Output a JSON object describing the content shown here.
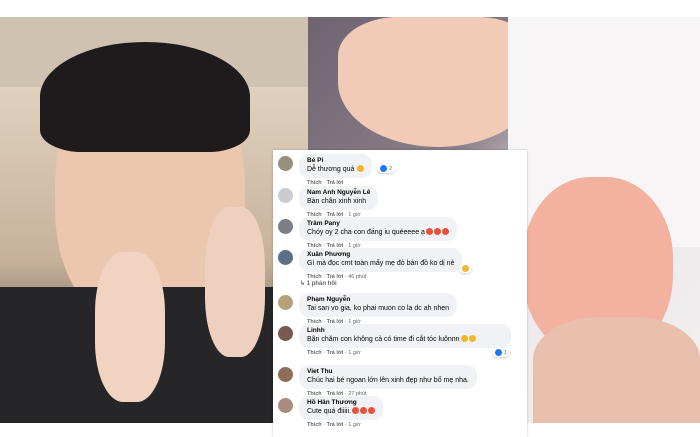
{
  "comments": [
    {
      "name": "Bé Pi",
      "text": "Dễ thương quá",
      "emoji": [
        "heart-eyes"
      ],
      "meta": [
        "Thích",
        "Trả lời"
      ],
      "time": "",
      "reactions": "2"
    },
    {
      "name": "Nam Anh Nguyễn Lê",
      "text": "Bàn chân xinh xinh",
      "emoji": [],
      "meta": [
        "Thích",
        "Trả lời"
      ],
      "time": "1 giờ",
      "reactions": ""
    },
    {
      "name": "Trâm Pany",
      "text": "Chóy oy 2 cha con đáng iu quéeeee ạ",
      "emoji": [
        "heart-eyes",
        "heart-eyes",
        "heart-eyes"
      ],
      "meta": [
        "Thích",
        "Trả lời"
      ],
      "time": "1 giờ",
      "reactions": ""
    },
    {
      "name": "Xuân Phương",
      "text": "Gì mà đọc cmt toàn mấy mẹ đò bán đồ ko dị nè",
      "emoji": [],
      "meta": [
        "Thích",
        "Trả lời"
      ],
      "time": "46 phút",
      "reactions": ""
    },
    {
      "name": "Phạm Nguyễn",
      "text": "Tai san vo gia, ko phai muon co la dc ah nhen",
      "emoji": [],
      "meta": [
        "Thích",
        "Trả lời"
      ],
      "time": "1 giờ",
      "reactions": ""
    },
    {
      "name": "Linhh",
      "text": "Bận chăm con không cả có time đi cắt tóc luônnn",
      "emoji": [
        "grin"
      ],
      "meta": [
        "Thích",
        "Trả lời"
      ],
      "time": "1 giờ",
      "reactions": "1"
    },
    {
      "name": "Viet Thu",
      "text": "Chúc hai bé ngoan lớn lên xinh đẹp như bố mẹ nha.",
      "emoji": [],
      "meta": [
        "Thích",
        "Trả lời"
      ],
      "time": "27 phút",
      "reactions": ""
    },
    {
      "name": "Hồ Hân Thương",
      "text": "Cute quá điiiii.",
      "emoji": [
        "heart-eyes",
        "heart-eyes",
        "heart-eyes"
      ],
      "meta": [
        "Thích",
        "Trả lời"
      ],
      "time": "1 giờ",
      "reactions": ""
    }
  ],
  "replies_link": "1 phản hồi",
  "colors": {
    "bubble": "#f0f2f5",
    "meta": "#65676b",
    "like": "#1877f2"
  }
}
